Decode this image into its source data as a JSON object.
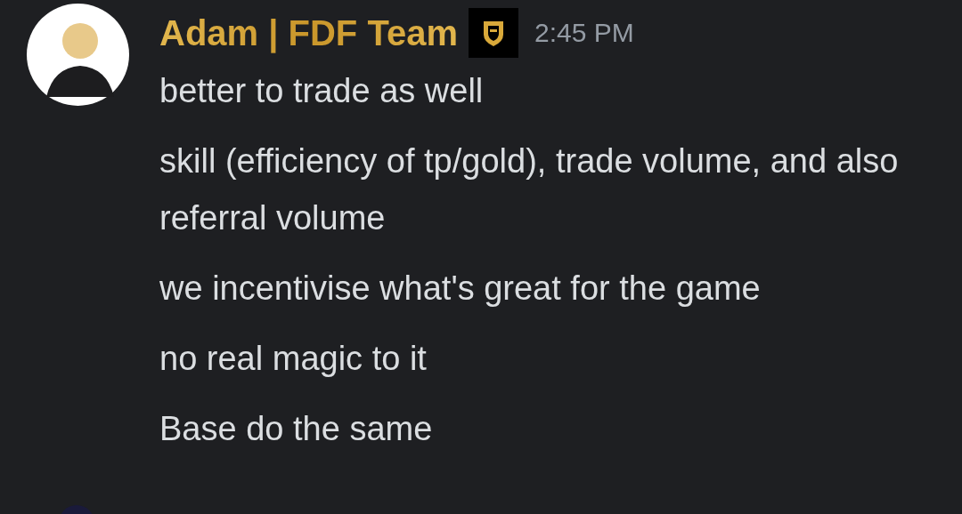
{
  "message_group": {
    "author": "Adam | FDF Team",
    "timestamp": "2:45 PM",
    "messages": [
      "better to trade as well",
      "skill (efficiency of tp/gold), trade volume, and also referral volume",
      "we incentivise what's great for the game",
      "no real magic to it",
      "Base do the same"
    ]
  }
}
